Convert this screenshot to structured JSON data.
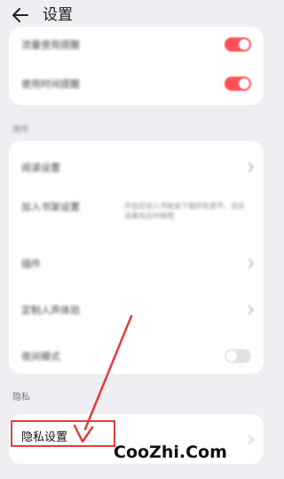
{
  "header": {
    "title": "设置"
  },
  "toggles_card": {
    "rows": [
      {
        "label": "流量使用提醒",
        "toggle": "on"
      },
      {
        "label": "使用时间提醒",
        "toggle": "on"
      }
    ]
  },
  "general_section": {
    "title": "通用",
    "rows": [
      {
        "label": "阅读设置"
      },
      {
        "label": "加入书架设置",
        "desc": "开启后加入书架会下载所有章节，适合流量充足时使用"
      },
      {
        "label": "插件"
      },
      {
        "label": "定制人声体验"
      },
      {
        "label": "夜间模式",
        "toggle": "off"
      }
    ]
  },
  "privacy_section": {
    "title": "隐私",
    "row_label": "隐私设置"
  },
  "watermark": "CooZhi.Com",
  "colors": {
    "accent": "#ff4f57",
    "annotation": "#e53c3c"
  }
}
